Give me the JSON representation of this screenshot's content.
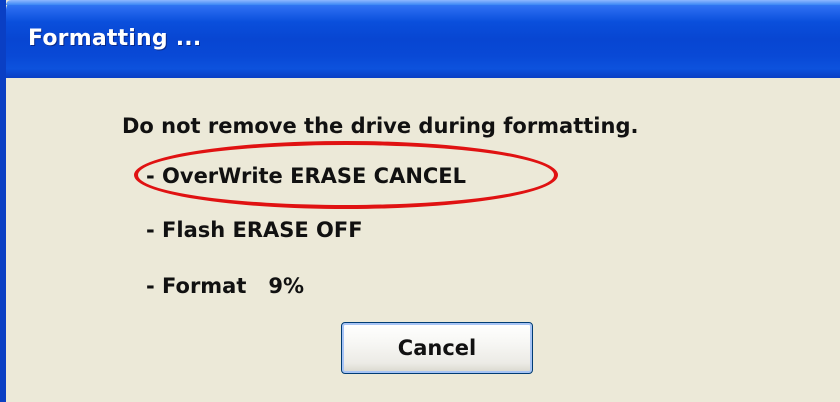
{
  "window": {
    "title": "Formatting ..."
  },
  "message": {
    "heading": "Do not remove the drive during formatting.",
    "overwrite_line": "- OverWrite ERASE CANCEL",
    "flash_line": "- Flash ERASE OFF",
    "format_line": "- Format   9%"
  },
  "progress": {
    "format_percent": 9
  },
  "buttons": {
    "cancel_label": "Cancel"
  },
  "colors": {
    "titlebar_blue": "#0846d2",
    "dialog_background": "#ece9d8",
    "highlight_red": "#e01212"
  }
}
